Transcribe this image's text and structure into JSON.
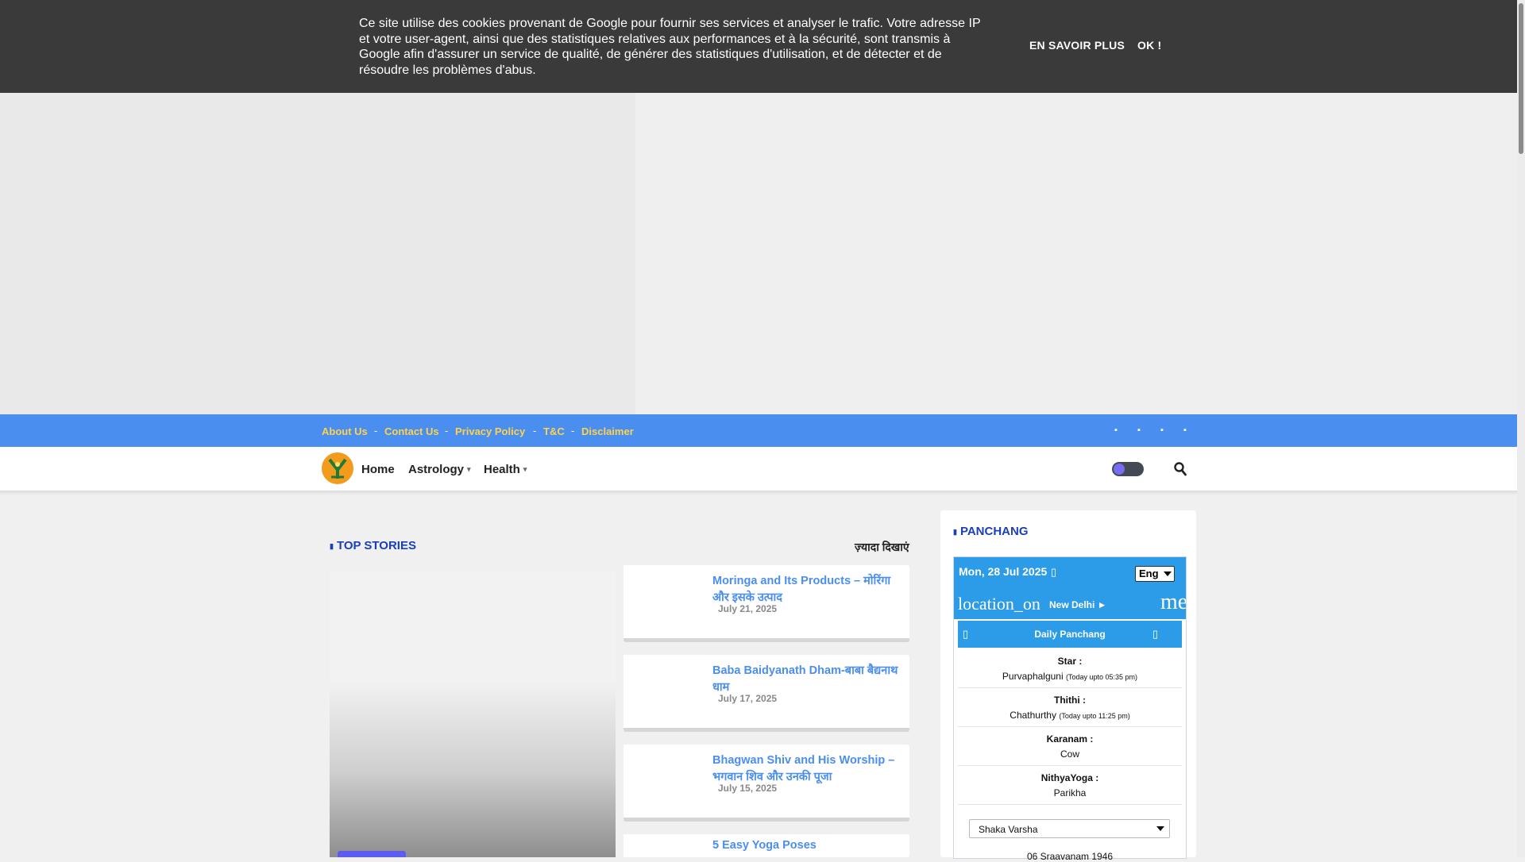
{
  "cookie": {
    "text": "Ce site utilise des cookies provenant de Google pour fournir ses services et analyser le trafic. Votre adresse IP et votre user-agent, ainsi que des statistiques relatives aux performances et à la sécurité, sont transmis à Google afin d'assurer un service de qualité, de générer des statistiques d'utilisation, et de détecter et de résoudre les problèmes d'abus.",
    "more_label": "EN SAVOIR PLUS",
    "ok_label": "OK !"
  },
  "topbar": {
    "links": [
      "About Us",
      "Contact Us",
      "Privacy Policy",
      "T&C",
      "Disclaimer"
    ],
    "separator": "-"
  },
  "nav": {
    "items": [
      "Home",
      "Astrology",
      "Health"
    ]
  },
  "top_stories": {
    "title": "TOP STORIES",
    "more_label": "ज़्यादा दिखाएं",
    "cards": [
      {
        "title": "Moringa and Its Products – मोरिंगा और इसके उत्पाद",
        "date": "July 21, 2025"
      },
      {
        "title": "Baba Baidyanath Dham-बाबा बैद्यनाथ धाम",
        "date": "July 17, 2025"
      },
      {
        "title": "Bhagwan Shiv and His Worship – भगवान शिव और उनकी पूजा",
        "date": "July 15, 2025"
      },
      {
        "title": "5 Easy Yoga Poses",
        "date": ""
      }
    ]
  },
  "panchang": {
    "title": "PANCHANG",
    "date": "Mon, 28 Jul 2025",
    "lang": "Eng",
    "location_icon_text": "location_on",
    "location": "New Delhi ►",
    "menu_icon_text": "menu",
    "tab_label": "Daily Panchang",
    "rows": [
      {
        "label": "Star :",
        "value": "Purvaphalguni",
        "note": "(Today upto 05:35 pm)"
      },
      {
        "label": "Thithi :",
        "value": "Chathurthy",
        "note": "(Today upto 11:25 pm)"
      },
      {
        "label": "Karanam :",
        "value": "Cow",
        "note": ""
      },
      {
        "label": "NithyaYoga :",
        "value": "Parikha",
        "note": ""
      }
    ],
    "select_value": "Shaka Varsha",
    "era_value": "06 Sraavanam 1946"
  },
  "colors": {
    "accent_blue": "#4a8ef0",
    "link_yellow": "#ffd24a",
    "heading_blue": "#1a3fb8",
    "panchang_blue": "#2c9be8"
  }
}
